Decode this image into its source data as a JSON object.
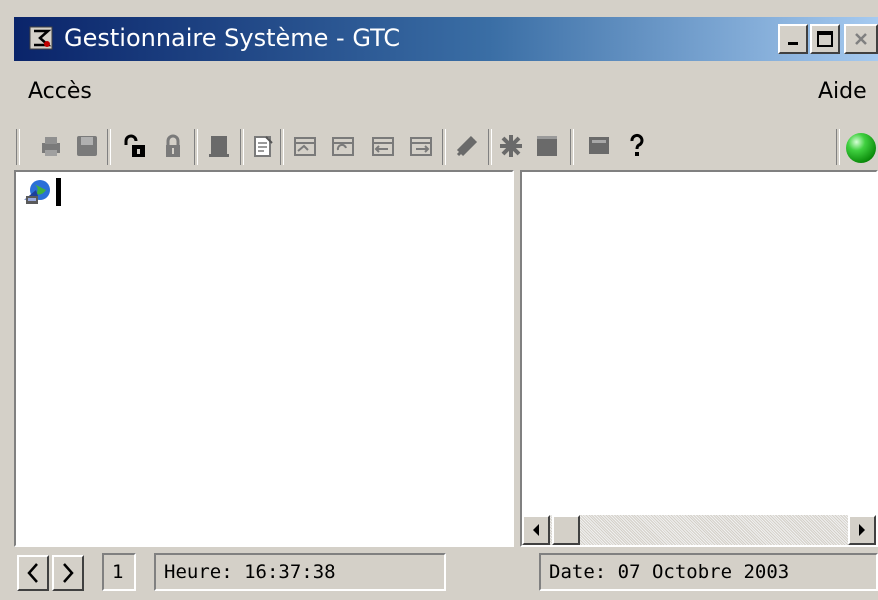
{
  "window": {
    "title": "Gestionnaire Système - GTC"
  },
  "menu": {
    "left": "Accès",
    "right": "Aide"
  },
  "toolbar": {
    "icons": [
      "printer-icon",
      "save-icon",
      "unlock-icon",
      "lock-icon",
      "server-icon",
      "document-edit-icon",
      "rack-icon-1",
      "rack-icon-2",
      "rack-icon-3",
      "rack-icon-4",
      "tools-icon",
      "network-icon",
      "window-icon",
      "monitor-icon",
      "help-icon"
    ],
    "status_color": "#1fb81f"
  },
  "statusbar": {
    "page": "1",
    "time": "Heure: 16:37:38",
    "date": "Date: 07 Octobre 2003"
  },
  "colors": {
    "title_start": "#0a246a",
    "title_end": "#a6caf0",
    "chrome": "#d4d0c8"
  }
}
